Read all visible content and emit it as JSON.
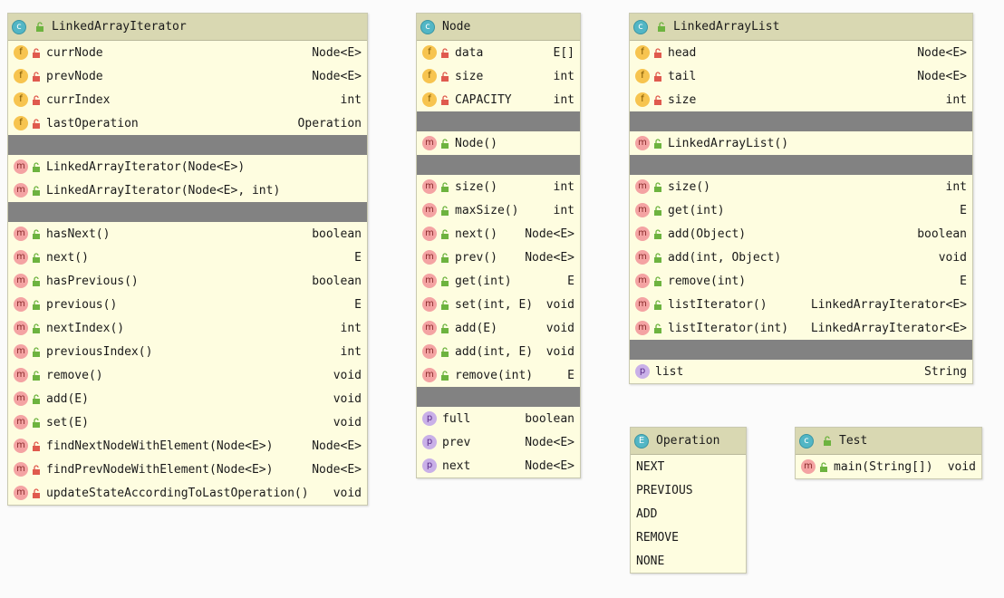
{
  "colors": {
    "header_bg": "#d9d8b2",
    "body_bg": "#fefde0",
    "separator": "#828282",
    "field_icon": "#f7c44f",
    "method_icon": "#f4a3a3",
    "property_icon": "#c9b0e8",
    "class_icon": "#52b6c5",
    "private_lock": "#e05a4e",
    "public_lock": "#6db33f"
  },
  "iterator": {
    "title": "LinkedArrayIterator",
    "fields": [
      {
        "name": "currNode",
        "type": "Node<E>"
      },
      {
        "name": "prevNode",
        "type": "Node<E>"
      },
      {
        "name": "currIndex",
        "type": "int"
      },
      {
        "name": "lastOperation",
        "type": "Operation"
      }
    ],
    "constructors": [
      {
        "name": "LinkedArrayIterator(Node<E>)",
        "type": ""
      },
      {
        "name": "LinkedArrayIterator(Node<E>, int)",
        "type": ""
      }
    ],
    "methods": [
      {
        "name": "hasNext()",
        "type": "boolean"
      },
      {
        "name": "next()",
        "type": "E"
      },
      {
        "name": "hasPrevious()",
        "type": "boolean"
      },
      {
        "name": "previous()",
        "type": "E"
      },
      {
        "name": "nextIndex()",
        "type": "int"
      },
      {
        "name": "previousIndex()",
        "type": "int"
      },
      {
        "name": "remove()",
        "type": "void"
      },
      {
        "name": "add(E)",
        "type": "void"
      },
      {
        "name": "set(E)",
        "type": "void"
      },
      {
        "name": "findNextNodeWithElement(Node<E>)",
        "type": "Node<E>"
      },
      {
        "name": "findPrevNodeWithElement(Node<E>)",
        "type": "Node<E>"
      },
      {
        "name": "updateStateAccordingToLastOperation()",
        "type": "void"
      }
    ]
  },
  "node": {
    "title": "Node",
    "fields": [
      {
        "name": "data",
        "type": "E[]"
      },
      {
        "name": "size",
        "type": "int"
      },
      {
        "name": "CAPACITY",
        "type": "int"
      }
    ],
    "constructors": [
      {
        "name": "Node()",
        "type": ""
      }
    ],
    "methods": [
      {
        "name": "size()",
        "type": "int"
      },
      {
        "name": "maxSize()",
        "type": "int"
      },
      {
        "name": "next()",
        "type": "Node<E>"
      },
      {
        "name": "prev()",
        "type": "Node<E>"
      },
      {
        "name": "get(int)",
        "type": "E"
      },
      {
        "name": "set(int, E)",
        "type": "void"
      },
      {
        "name": "add(E)",
        "type": "void"
      },
      {
        "name": "add(int, E)",
        "type": "void"
      },
      {
        "name": "remove(int)",
        "type": "E"
      }
    ],
    "properties": [
      {
        "name": "full",
        "type": "boolean"
      },
      {
        "name": "prev",
        "type": "Node<E>"
      },
      {
        "name": "next",
        "type": "Node<E>"
      }
    ]
  },
  "list": {
    "title": "LinkedArrayList",
    "fields": [
      {
        "name": "head",
        "type": "Node<E>"
      },
      {
        "name": "tail",
        "type": "Node<E>"
      },
      {
        "name": "size",
        "type": "int"
      }
    ],
    "constructors": [
      {
        "name": "LinkedArrayList()",
        "type": ""
      }
    ],
    "methods": [
      {
        "name": "size()",
        "type": "int"
      },
      {
        "name": "get(int)",
        "type": "E"
      },
      {
        "name": "add(Object)",
        "type": "boolean"
      },
      {
        "name": "add(int, Object)",
        "type": "void"
      },
      {
        "name": "remove(int)",
        "type": "E"
      },
      {
        "name": "listIterator()",
        "type": "LinkedArrayIterator<E>"
      },
      {
        "name": "listIterator(int)",
        "type": "LinkedArrayIterator<E>"
      }
    ],
    "properties": [
      {
        "name": "list",
        "type": "String"
      }
    ]
  },
  "operation": {
    "title": "Operation",
    "values": [
      "NEXT",
      "PREVIOUS",
      "ADD",
      "REMOVE",
      "NONE"
    ]
  },
  "test": {
    "title": "Test",
    "methods": [
      {
        "name": "main(String[])",
        "type": "void"
      }
    ]
  }
}
